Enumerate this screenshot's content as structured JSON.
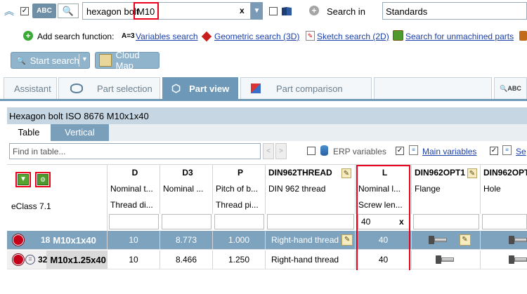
{
  "search": {
    "query_text": "hexagon bolt ",
    "query_highlight": "M10",
    "clear_symbol": "x",
    "search_in_label": "Search in",
    "search_in_value": "Standards",
    "abc_label": "ABC"
  },
  "add_search": {
    "label": "Add search function:",
    "variables_prefix": "A=3",
    "variables": "Variables search",
    "geometric": "Geometric search (3D)",
    "sketch": "Sketch search (2D)",
    "unmachined": "Search for unmachined parts"
  },
  "actions": {
    "start_search": "Start search",
    "cloud_map": "Cloud Map"
  },
  "tabs": [
    {
      "label": "Assistant"
    },
    {
      "label": "Part selection"
    },
    {
      "label": "Part view"
    },
    {
      "label": "Part comparison"
    }
  ],
  "part_title": "Hexagon bolt ISO 8676 M10x1x40",
  "subtabs": {
    "table": "Table",
    "vertical": "Vertical"
  },
  "table_tools": {
    "find_placeholder": "Find in table...",
    "erp_variables": "ERP variables",
    "main_variables": "Main variables",
    "sec_cut": "Se"
  },
  "grid": {
    "eclass": "eClass 7.1",
    "columns": [
      {
        "title": "D",
        "line2": "Nominal t...",
        "line3": "Thread di..."
      },
      {
        "title": "D3",
        "line2": "Nominal ...",
        "line3": ""
      },
      {
        "title": "P",
        "line2": "Pitch of b...",
        "line3": "Thread pi..."
      },
      {
        "title": "DIN962THREAD",
        "line2": "DIN 962 thread",
        "line3": ""
      },
      {
        "title": "L",
        "line2": "Nominal l...",
        "line3": "Screw len..."
      },
      {
        "title": "DIN962OPT1",
        "line2": "Flange",
        "line3": ""
      },
      {
        "title": "DIN962OPT",
        "line2": "Hole",
        "line3": ""
      }
    ],
    "l_filter_value": "40",
    "l_filter_clear": "x",
    "rows": [
      {
        "num": "18",
        "name": "M10x1x40",
        "D": "10",
        "D3": "8.773",
        "P": "1.000",
        "thread": "Right-hand thread",
        "L": "40"
      },
      {
        "num": "32",
        "name": "M10x1.25x40",
        "D": "10",
        "D3": "8.466",
        "P": "1.250",
        "thread": "Right-hand thread",
        "L": "40"
      }
    ]
  },
  "colors": {
    "accent_blue": "#6d98b8",
    "selected_row": "#7ea3bf",
    "highlight_red": "#e8001c"
  }
}
